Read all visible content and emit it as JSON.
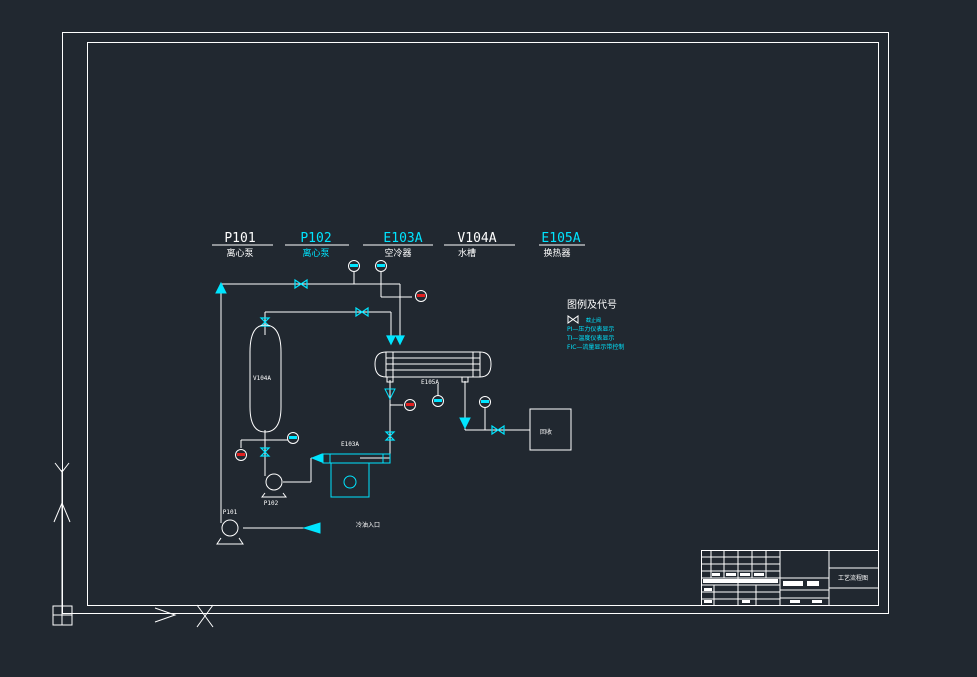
{
  "colors": {
    "background": "#212830",
    "line": "#ffffff",
    "accent": "#00e5ff",
    "alarm": "#e02020"
  },
  "equipment_list": [
    {
      "tag": "P101",
      "name": "离心泵",
      "color": "#ffffff"
    },
    {
      "tag": "P102",
      "name": "离心泵",
      "color": "#00e5ff"
    },
    {
      "tag": "E103A",
      "name": "空冷器",
      "color": "#00e5ff"
    },
    {
      "tag": "V104A",
      "name": "水槽",
      "color": "#ffffff"
    },
    {
      "tag": "E105A",
      "name": "换热器",
      "color": "#00e5ff"
    }
  ],
  "legend": {
    "title": "图例及代号",
    "valve_label": "截止阀",
    "items": [
      "PI—压力仪表显示",
      "TI—温度仪表显示",
      "FIC—流量显示带控制"
    ]
  },
  "diagram": {
    "tank_label": "V104A",
    "exchanger_label": "E105A",
    "cooler_label": "E103A",
    "pump1_label": "P101",
    "pump2_label": "P102",
    "inlet_label": "冷油入口",
    "recovery_label": "回收"
  },
  "title_block": {
    "drawing_title": "工艺流程图"
  }
}
